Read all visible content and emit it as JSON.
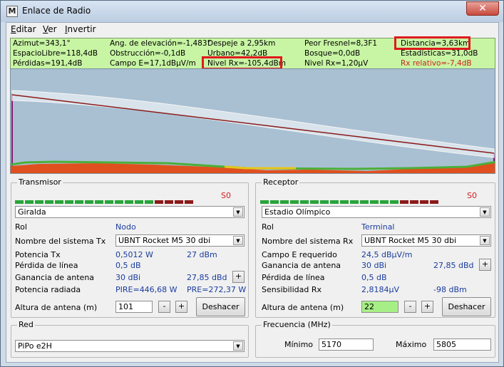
{
  "window": {
    "title": "Enlace de Radio",
    "app_icon_glyph": "M",
    "close_glyph": "✕"
  },
  "menu": [
    {
      "key": "E",
      "rest": "ditar"
    },
    {
      "key": "V",
      "rest": "er"
    },
    {
      "key": "I",
      "rest": "nvertir"
    }
  ],
  "info": {
    "row1": [
      "Azimut=343,1°",
      "Ang. de elevación=-1,483°",
      "Despeje a 2,95km",
      "Peor Fresnel=8,3F1",
      "Distancia=3,63km"
    ],
    "row2": [
      "EspacioLibre=118,4dB",
      "Obstrucción=-0,1dB",
      "Urbano=42,2dB",
      "Bosque=0,0dB",
      "Estadísticas=31,0dB"
    ],
    "row3": [
      "Pérdidas=191,4dB",
      "Campo E=17,1dBµV/m",
      "Nivel Rx=-105,4dBm",
      "Nivel Rx=1,20µV",
      "Rx relativo=-7,4dB"
    ],
    "colors": {
      "rx_relative": "#d0201e"
    }
  },
  "profile": {
    "colors": {
      "sky": "#a9c0d3",
      "terrain": "#e0501e",
      "vegetation": "#4caf3a",
      "link": "#8b1a1a"
    }
  },
  "transmitter": {
    "group_label": "Transmisor",
    "signal": "S0",
    "site": "Giralda",
    "rol_label": "Rol",
    "rol_value": "Nodo",
    "system_label": "Nombre del sistema Tx",
    "system_value": "UBNT Rocket M5 30 dbi",
    "power_label": "Potencia Tx",
    "power_w": "0,5012 W",
    "power_dbm": "27 dBm",
    "line_loss_label": "Pérdida de línea",
    "line_loss": "0,5 dB",
    "gain_label": "Ganancia de antena",
    "gain_dbi": "30 dBi",
    "gain_dbd": "27,85 dBd",
    "radiated_label": "Potencia radiada",
    "pire": "PIRE=446,68 W",
    "pre": "PRE=272,37 W",
    "height_label": "Altura de antena (m)",
    "height": "101",
    "minus": "-",
    "plus": "+",
    "undo": "Deshacer"
  },
  "receiver": {
    "group_label": "Receptor",
    "signal": "S0",
    "site": "Estadio Olímpico",
    "rol_label": "Rol",
    "rol_value": "Terminal",
    "system_label": "Nombre del sistema Rx",
    "system_value": "UBNT Rocket M5 30 dbi",
    "field_label": "Campo E requerido",
    "field_value": "24,5 dBµV/m",
    "gain_label": "Ganancia de antena",
    "gain_dbi": "30 dBi",
    "gain_dbd": "27,85 dBd",
    "line_loss_label": "Pérdida de línea",
    "line_loss": "0,5 dB",
    "sens_label": "Sensibilidad Rx",
    "sens_uv": "2,8184µV",
    "sens_dbm": "-98 dBm",
    "height_label": "Altura de antena (m)",
    "height": "22",
    "minus": "-",
    "plus": "+",
    "undo": "Deshacer"
  },
  "network": {
    "group_label": "Red",
    "value": "PiPo e2H"
  },
  "frequency": {
    "group_label": "Frecuencia (MHz)",
    "min_label": "Mínimo",
    "min": "5170",
    "max_label": "Máximo",
    "max": "5805"
  }
}
